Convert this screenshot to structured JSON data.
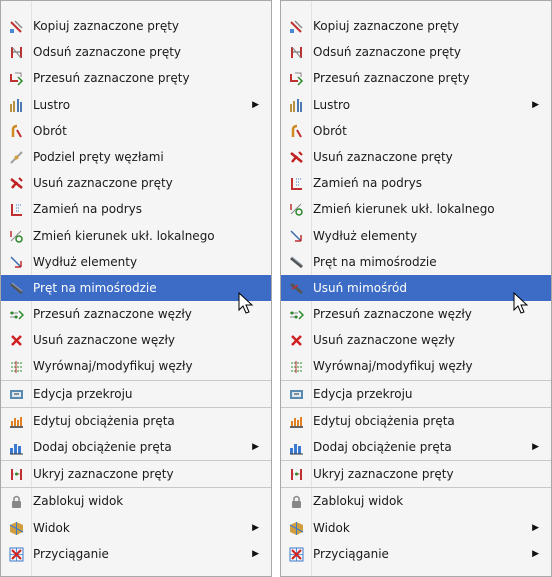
{
  "menu_left": [
    {
      "label": "Kopiuj zaznaczone pręty",
      "icon": "copy-bars-icon"
    },
    {
      "label": "Odsuń zaznaczone pręty",
      "icon": "offset-bars-icon"
    },
    {
      "label": "Przesuń zaznaczone pręty",
      "icon": "move-bars-icon"
    },
    {
      "label": "Lustro",
      "icon": "mirror-icon",
      "submenu": true
    },
    {
      "label": "Obrót",
      "icon": "rotate-icon"
    },
    {
      "label": "Podziel pręty węzłami",
      "icon": "divide-bars-icon"
    },
    {
      "label": "Usuń zaznaczone pręty",
      "icon": "delete-bars-icon"
    },
    {
      "label": "Zamień na podrys",
      "icon": "convert-underlay-icon"
    },
    {
      "label": "Zmień kierunek ukł. lokalnego",
      "icon": "change-local-axis-icon"
    },
    {
      "label": "Wydłuż elementy",
      "icon": "extend-elements-icon"
    },
    {
      "label": "Pręt na mimośrodzie",
      "icon": "eccentric-bar-icon",
      "highlighted": true
    },
    {
      "label": "Przesuń zaznaczone węzły",
      "icon": "move-nodes-icon"
    },
    {
      "label": "Usuń zaznaczone węzły",
      "icon": "delete-nodes-icon"
    },
    {
      "label": "Wyrównaj/modyfikuj węzły",
      "icon": "align-nodes-icon",
      "separator": true
    },
    {
      "label": "Edycja przekroju",
      "icon": "section-edit-icon",
      "separator": true
    },
    {
      "label": "Edytuj obciążenia pręta",
      "icon": "edit-loads-icon"
    },
    {
      "label": "Dodaj obciążenie pręta",
      "icon": "add-load-icon",
      "submenu": true,
      "separator": true
    },
    {
      "label": "Ukryj zaznaczone pręty",
      "icon": "hide-bars-icon",
      "separator": true
    },
    {
      "label": "Zablokuj widok",
      "icon": "lock-view-icon"
    },
    {
      "label": "Widok",
      "icon": "view-icon",
      "submenu": true
    },
    {
      "label": "Przyciąganie",
      "icon": "snapping-icon",
      "submenu": true
    }
  ],
  "menu_right": [
    {
      "label": "Kopiuj zaznaczone pręty",
      "icon": "copy-bars-icon"
    },
    {
      "label": "Odsuń zaznaczone pręty",
      "icon": "offset-bars-icon"
    },
    {
      "label": "Przesuń zaznaczone pręty",
      "icon": "move-bars-icon"
    },
    {
      "label": "Lustro",
      "icon": "mirror-icon",
      "submenu": true
    },
    {
      "label": "Obrót",
      "icon": "rotate-icon"
    },
    {
      "label": "Usuń zaznaczone pręty",
      "icon": "delete-bars-icon"
    },
    {
      "label": "Zamień na podrys",
      "icon": "convert-underlay-icon"
    },
    {
      "label": "Zmień kierunek ukł. lokalnego",
      "icon": "change-local-axis-icon"
    },
    {
      "label": "Wydłuż elementy",
      "icon": "extend-elements-icon"
    },
    {
      "label": "Pręt na mimośrodzie",
      "icon": "eccentric-bar-icon"
    },
    {
      "label": "Usuń mimośród",
      "icon": "remove-eccentricity-icon",
      "highlighted": true
    },
    {
      "label": "Przesuń zaznaczone węzły",
      "icon": "move-nodes-icon"
    },
    {
      "label": "Usuń zaznaczone węzły",
      "icon": "delete-nodes-icon"
    },
    {
      "label": "Wyrównaj/modyfikuj węzły",
      "icon": "align-nodes-icon",
      "separator": true
    },
    {
      "label": "Edycja przekroju",
      "icon": "section-edit-icon",
      "separator": true
    },
    {
      "label": "Edytuj obciążenia pręta",
      "icon": "edit-loads-icon"
    },
    {
      "label": "Dodaj obciążenie pręta",
      "icon": "add-load-icon",
      "submenu": true,
      "separator": true
    },
    {
      "label": "Ukryj zaznaczone pręty",
      "icon": "hide-bars-icon",
      "separator": true
    },
    {
      "label": "Zablokuj widok",
      "icon": "lock-view-icon"
    },
    {
      "label": "Widok",
      "icon": "view-icon",
      "submenu": true
    },
    {
      "label": "Przyciąganie",
      "icon": "snapping-icon",
      "submenu": true
    }
  ],
  "colors": {
    "highlight": "#3d6cc6",
    "menu_background": "#f5f5f5",
    "text": "#1a1a1a"
  }
}
